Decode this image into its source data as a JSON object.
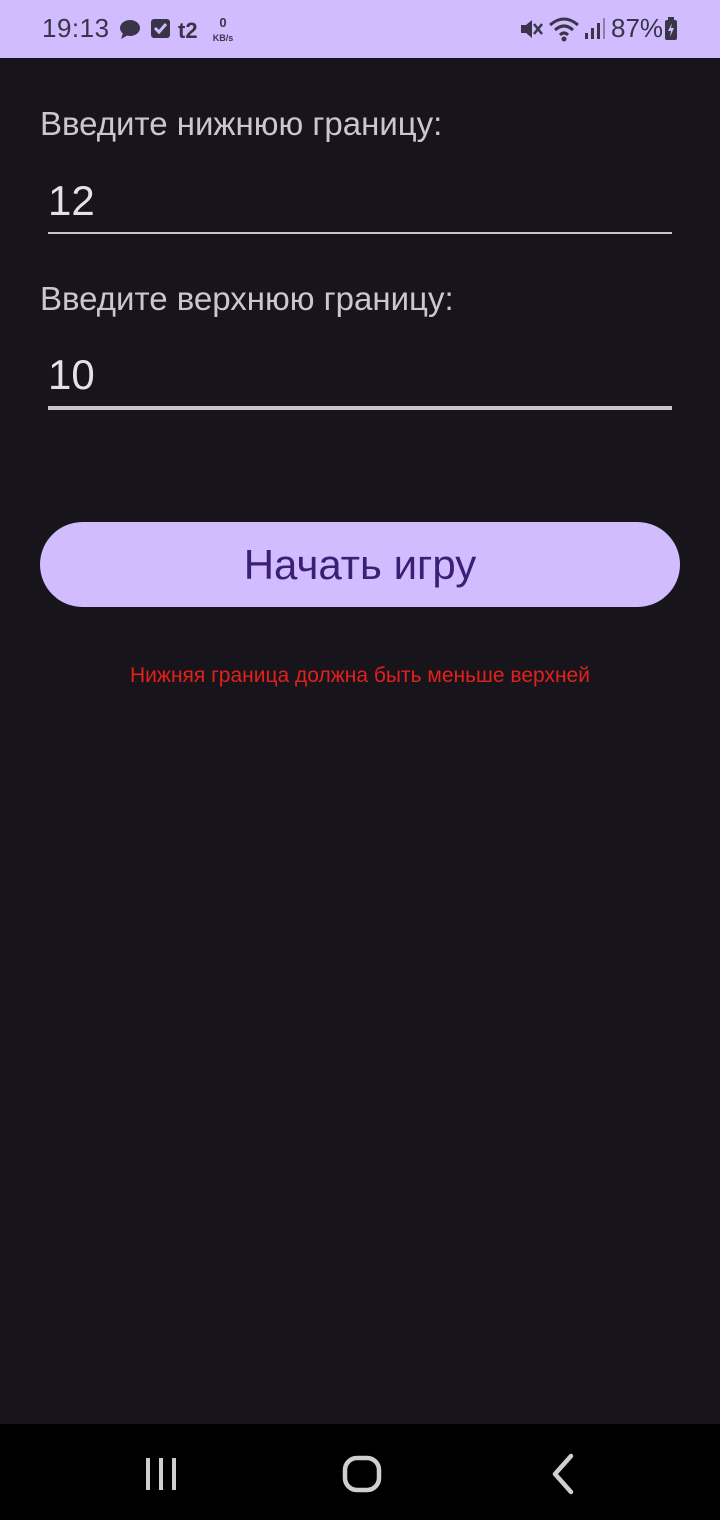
{
  "status_bar": {
    "time": "19:13",
    "data_rate_value": "0",
    "data_rate_unit": "KB/s",
    "battery_percent": "87%",
    "icons": [
      "message-icon",
      "checkbox-notification-icon",
      "t2-carrier-icon",
      "mute-icon",
      "wifi-icon",
      "signal-icon",
      "battery-charging-icon"
    ],
    "background_color": "#d0bcfe"
  },
  "form": {
    "lower_label": "Введите нижнюю границу:",
    "lower_value": "12",
    "upper_label": "Введите верхнюю границу:",
    "upper_value": "10",
    "start_button_label": "Начать игру",
    "error_message": "Нижняя граница должна быть меньше верхней"
  },
  "colors": {
    "background": "#17151b",
    "accent": "#d0bcfe",
    "button_text": "#3a1f74",
    "error": "#e3201b"
  },
  "nav_bar": {
    "icons": [
      "recent-apps-icon",
      "home-icon",
      "back-icon"
    ]
  }
}
